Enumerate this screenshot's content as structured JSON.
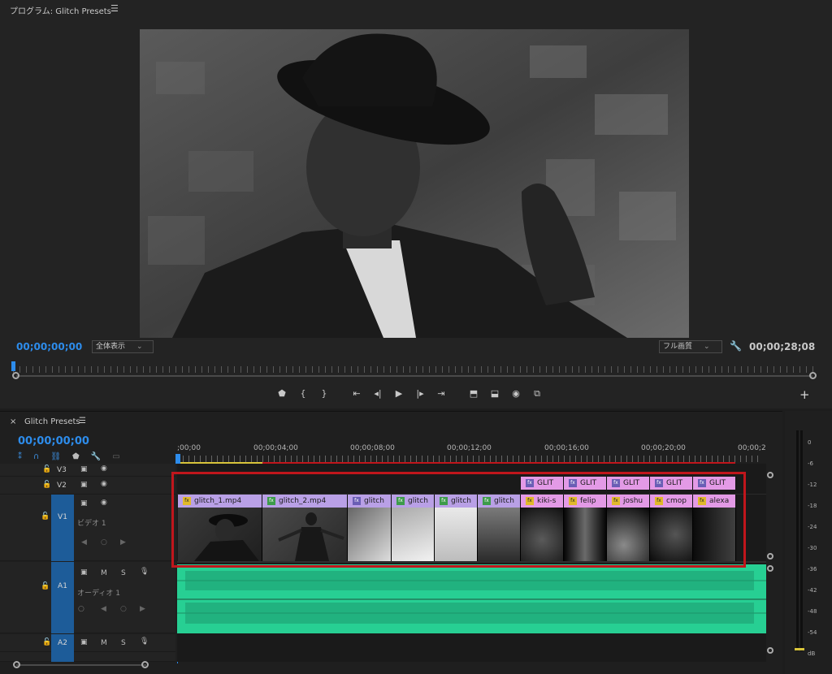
{
  "program": {
    "title": "プログラム: Glitch Presets",
    "timecode_current": "00;00;00;00",
    "fit_dropdown": "全体表示",
    "quality_dropdown": "フル画質",
    "timecode_duration": "00;00;28;08",
    "add_label": "+"
  },
  "timeline": {
    "close_label": "×",
    "title": "Glitch Presets",
    "timecode": "00;00;00;00",
    "ruler": [
      ";00;00",
      "00;00;04;00",
      "00;00;08;00",
      "00;00;12;00",
      "00;00;16;00",
      "00;00;20;00",
      "00;00;2"
    ],
    "tracks": {
      "v3": "V3",
      "v2": "V2",
      "v1": "V1",
      "v1_name": "ビデオ 1",
      "a1": "A1",
      "a1_name": "オーディオ 1",
      "a2": "A2",
      "m_label": "M",
      "s_label": "S"
    },
    "v1_clips": [
      "glitch_1.mp4",
      "glitch_2.mp4",
      "glitch",
      "glitch",
      "glitch",
      "glitch",
      "kiki-s",
      "felip",
      "joshu",
      "cmop",
      "alexa"
    ],
    "v2_clips": [
      "GLIT",
      "GLIT",
      "GLIT",
      "GLIT",
      "GLIT"
    ],
    "fx_label": "fx"
  },
  "meter": {
    "scale": [
      "0",
      "-6",
      "-12",
      "-18",
      "-24",
      "-30",
      "-36",
      "-42",
      "-48",
      "-54",
      "dB"
    ]
  },
  "colors": {
    "accent_blue": "#2d8ceb",
    "clip_purple": "#b9a0e6",
    "clip_pink": "#e39ae6",
    "audio_green": "#27cf93",
    "highlight_red": "#c0161c"
  }
}
